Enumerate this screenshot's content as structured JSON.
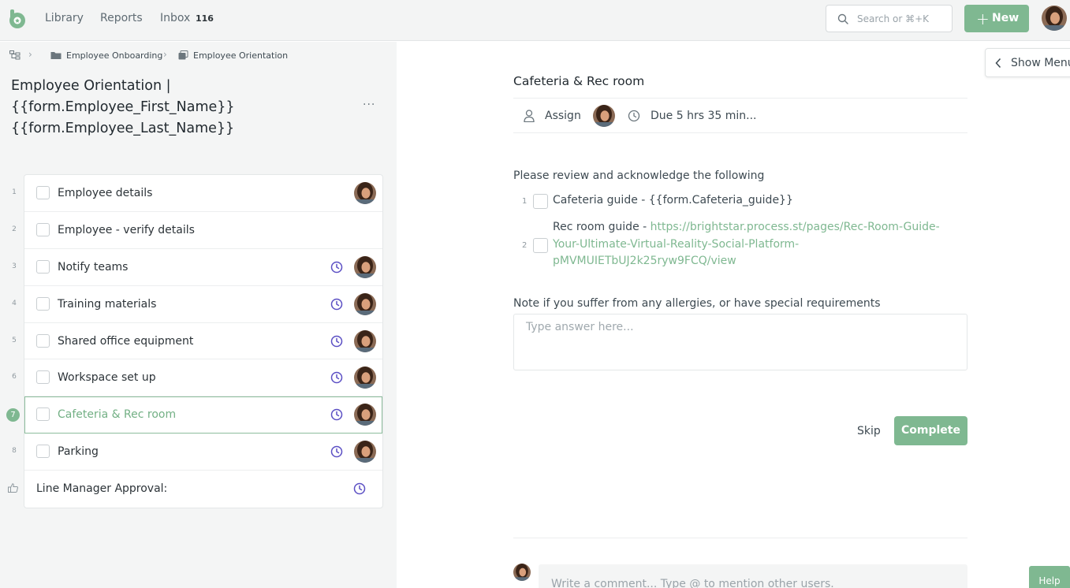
{
  "topbar": {
    "nav": {
      "library": "Library",
      "reports": "Reports",
      "inbox": "Inbox",
      "inbox_count": "116"
    },
    "search": {
      "placeholder": "Search or ⌘+K"
    },
    "new_button": {
      "plus": "+",
      "label": "New"
    }
  },
  "breadcrumb": {
    "items": [
      {
        "label": "Employee Onboarding",
        "icon": "folder-icon"
      },
      {
        "label": "Employee Orientation",
        "icon": "workflow-icon"
      }
    ],
    "separator": "›"
  },
  "document": {
    "title_lines": [
      "Employee Orientation |",
      "{{form.Employee_First_Name}}",
      "{{form.Employee_Last_Name}}"
    ],
    "more": "···"
  },
  "tasks": [
    {
      "num": "1",
      "name": "Employee details"
    },
    {
      "num": "2",
      "name": "Employee - verify details"
    },
    {
      "num": "3",
      "name": "Notify teams"
    },
    {
      "num": "4",
      "name": "Training materials"
    },
    {
      "num": "5",
      "name": "Shared office equipment"
    },
    {
      "num": "6",
      "name": "Workspace set up"
    },
    {
      "num": "7",
      "name": "Cafeteria & Rec room"
    },
    {
      "num": "8",
      "name": "Parking"
    },
    {
      "num": "",
      "name": "Line Manager Approval:"
    }
  ],
  "panel": {
    "show_menu": "Show Menu",
    "task_title": "Cafeteria & Rec room",
    "assign": "Assign",
    "due": "Due 5 hrs 35 min...",
    "section1": "Please review and acknowledge the following",
    "checklist": [
      {
        "num": "1",
        "text": "Cafeteria guide - {{form.Cafeteria_guide}}"
      },
      {
        "num": "2",
        "prefix": "Rec room guide - ",
        "link_lines": [
          "https://brightstar.process.st/pages/Rec-Room-Guide-",
          "Your-Ultimate-Virtual-Reality-Social-Platform-",
          "pMVMUIETbUJ2k25ryw9FCQ/view"
        ]
      }
    ],
    "section2": "Note if you suffer from any allergies, or have special requirements",
    "answer_placeholder": "Type answer here...",
    "skip": "Skip",
    "complete": "Complete",
    "comment_placeholder": "Write a comment... Type @ to mention other users.",
    "help": "Help"
  },
  "colors": {
    "accent": "#7fb891",
    "clock": "#5b4fc4",
    "active_outline": "#8dbd9c"
  }
}
